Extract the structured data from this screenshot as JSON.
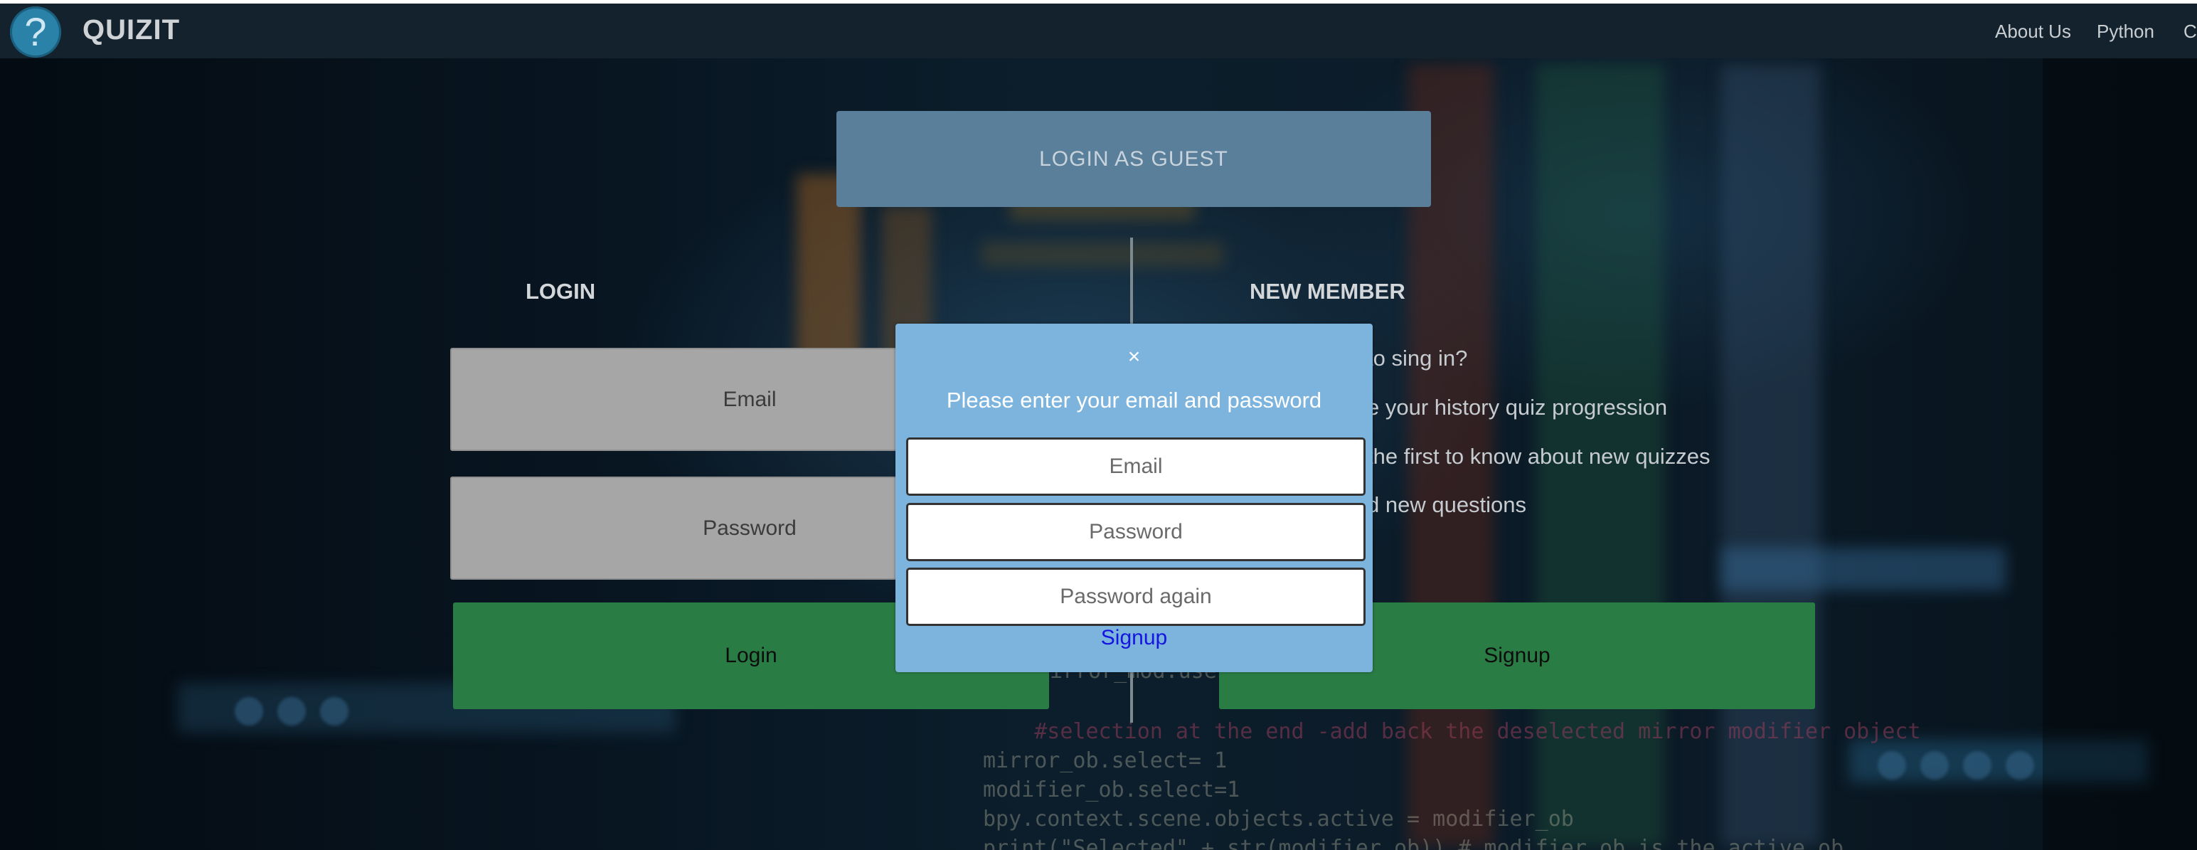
{
  "navbar": {
    "logo_glyph": "?",
    "brand": "QUIZIT",
    "links": [
      "About Us",
      "Python",
      "C"
    ]
  },
  "page": {
    "guest_button": "LOGIN AS GUEST",
    "login_title": "LOGIN",
    "new_member_title": "NEW MEMBER",
    "login_email_placeholder": "Email",
    "login_password_placeholder": "Password",
    "login_button": "Login",
    "signup_button": "Signup",
    "benefits": [
      "to sing in?",
      "e your history quiz progression",
      " the first to know about new quizzes",
      "d new questions"
    ]
  },
  "modal": {
    "close": "×",
    "title": "Please enter your email and password",
    "email_placeholder": "Email",
    "password_placeholder": "Password",
    "password_again_placeholder": "Password again",
    "signup_link": "Signup"
  },
  "background_code": [
    "    #selection at the end -add back the deselected mirror modifier object",
    "mirror_ob.select= 1",
    "modifier_ob.select=1",
    "bpy.context.scene.objects.active = modifier_ob",
    "print(\"Selected\" + str(modifier_ob)) # modifier ob is the active ob"
  ],
  "background_code_fragment": "irror_mod.use",
  "colors": {
    "navbar_bg": "#13222d",
    "guest_button_bg": "#5a7f9b",
    "green_button_bg": "#2a7c45",
    "modal_bg": "#7db4dd",
    "link_color": "#1515e0"
  }
}
